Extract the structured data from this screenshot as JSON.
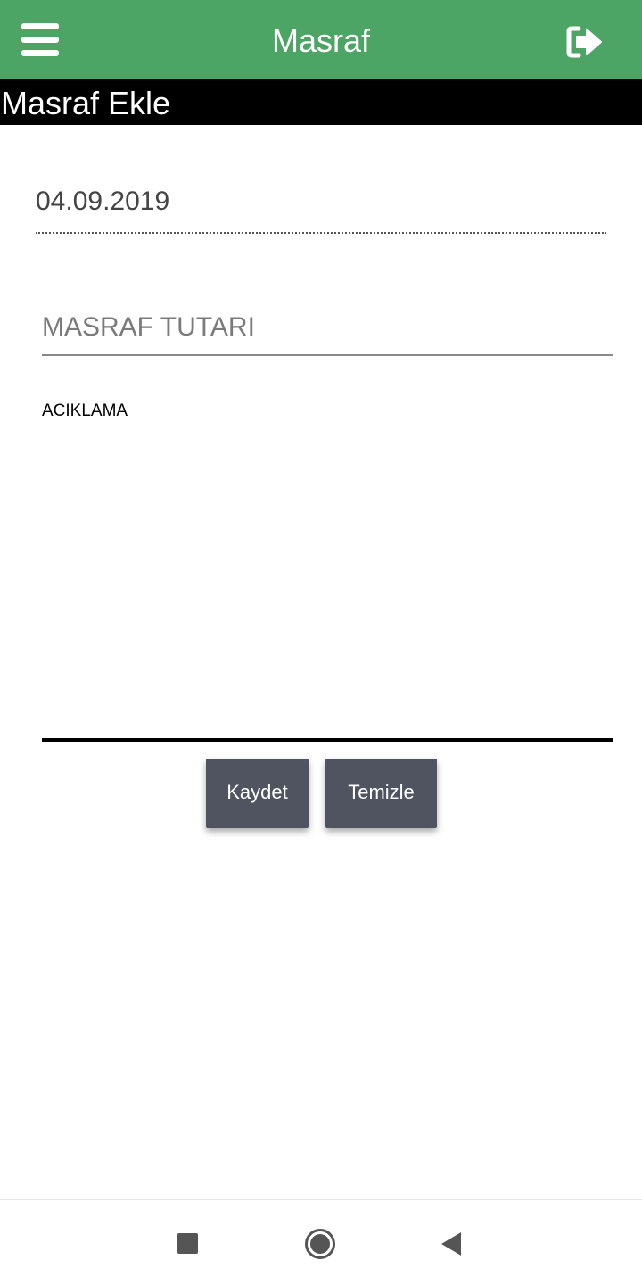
{
  "app_bar": {
    "title": "Masraf",
    "background_color": "#4ca564",
    "menu_icon": "hamburger-menu-icon",
    "logout_icon": "logout-icon"
  },
  "section": {
    "title": "Masraf Ekle"
  },
  "form": {
    "date_value": "04.09.2019",
    "amount_placeholder": "MASRAF TUTARI",
    "description_placeholder": "ACIKLAMA"
  },
  "buttons": {
    "save_label": "Kaydet",
    "clear_label": "Temizle",
    "color": "#4f5460"
  },
  "system_nav": {
    "recent_icon": "square-recents-icon",
    "home_icon": "circle-home-icon",
    "back_icon": "triangle-back-icon"
  }
}
